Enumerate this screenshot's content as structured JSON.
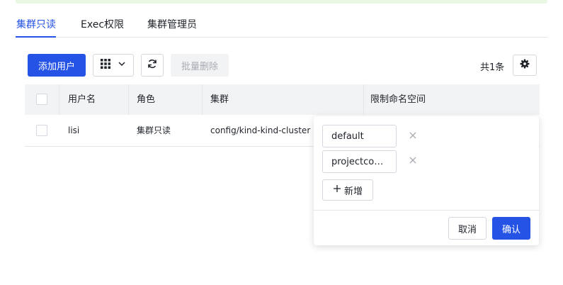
{
  "tabs": [
    {
      "label": "集群只读",
      "active": true
    },
    {
      "label": "Exec权限",
      "active": false
    },
    {
      "label": "集群管理员",
      "active": false
    }
  ],
  "toolbar": {
    "add_user_label": "添加用户",
    "view_icon": "grid-icon",
    "refresh_icon": "refresh-icon",
    "batch_delete_label": "批量删除",
    "total_label": "共1条",
    "settings_icon": "gear-icon"
  },
  "table": {
    "headers": {
      "username": "用户名",
      "role": "角色",
      "cluster": "集群",
      "namespace": "限制命名空间"
    },
    "rows": [
      {
        "username": "lisi",
        "role": "集群只读",
        "cluster": "config/kind-kind-cluster"
      }
    ]
  },
  "popover": {
    "namespaces": [
      "default",
      "projectcontour"
    ],
    "add_label": "新增",
    "cancel_label": "取消",
    "confirm_label": "确认"
  },
  "colors": {
    "primary": "#2453e6",
    "header_bg": "#f2f3f5",
    "border": "#d4d7de",
    "top_strip": "#e9f7e4"
  }
}
